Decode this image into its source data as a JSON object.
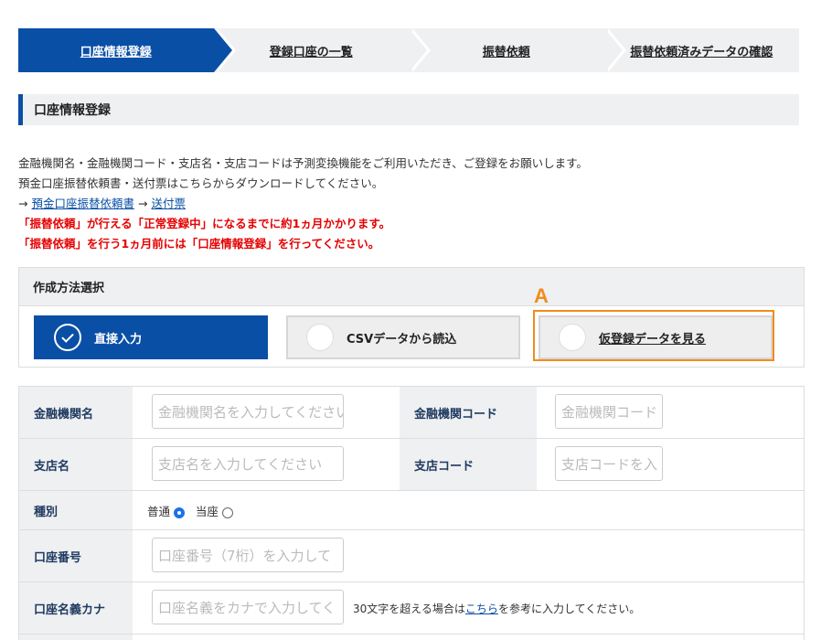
{
  "stepper": {
    "steps": [
      "口座情報登録",
      "登録口座の一覧",
      "振替依頼",
      "振替依頼済みデータの確認"
    ]
  },
  "section_title": "口座情報登録",
  "info": {
    "line1": "金融機関名・金融機関コード・支店名・支店コードは予測変換機能をご利用いただき、ご登録をお願いします。",
    "line2": "預金口座振替依頼書・送付票はこちらからダウンロードしてください。",
    "arrow": "→",
    "link1": "預金口座振替依頼書",
    "link2": "送付票",
    "warn1": "「振替依頼」が行える「正常登録中」になるまでに約1ヵ月かかります。",
    "warn2": "「振替依頼」を行う1ヵ月前には「口座情報登録」を行ってください。"
  },
  "method": {
    "heading": "作成方法選択",
    "options": [
      "直接入力",
      "CSVデータから読込",
      "仮登録データを見る"
    ],
    "selected": "直接入力",
    "annotation": "A"
  },
  "form": {
    "bank_name_label": "金融機関名",
    "bank_name_placeholder": "金融機関名を入力してください",
    "bank_code_label": "金融機関コード",
    "bank_code_placeholder": "金融機関コード",
    "branch_name_label": "支店名",
    "branch_name_placeholder": "支店名を入力してください",
    "branch_code_label": "支店コード",
    "branch_code_placeholder": "支店コードを入",
    "type_label": "種別",
    "type_options": [
      "普通",
      "当座"
    ],
    "type_selected": "普通",
    "account_number_label": "口座番号",
    "account_number_placeholder": "口座番号（7桁）を入力して",
    "account_name_label": "口座名義カナ",
    "account_name_placeholder": "口座名義をカナで入力してく",
    "note_prefix": "30文字を超える場合は",
    "note_link": "こちら",
    "note_suffix": "を参考に入力してください。"
  },
  "colors": {
    "primary": "#0a4fa6",
    "warning": "#e60000",
    "annotation": "#f08c1e",
    "label_bg": "#eef0f2"
  }
}
